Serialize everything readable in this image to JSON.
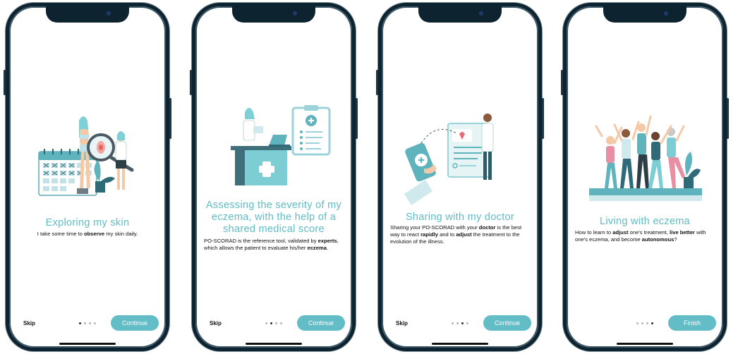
{
  "colors": {
    "accent": "#62bdc7",
    "title": "#5fbcc5",
    "frame": "#0d2330"
  },
  "screens": [
    {
      "title": "Exploring my skin",
      "body": [
        "I take some time to ",
        "observe",
        " my skin daily."
      ],
      "skip": "Skip",
      "button": "Continue",
      "active_dot": 1,
      "dots": 4
    },
    {
      "title": "Assessing the severity of my eczema, with the help of a shared medical score",
      "body": [
        "PO-SCORAD is the reference tool, validated by ",
        "experts",
        ", which allows the patient to evaluate his/her ",
        "eczema",
        "."
      ],
      "skip": "Skip",
      "button": "Continue",
      "active_dot": 2,
      "dots": 4
    },
    {
      "title": "Sharing with my doctor",
      "body": [
        "Sharing your PO-SCORAD with your ",
        "doctor",
        " is the best way to react ",
        "rapidly",
        " and to ",
        "adjust",
        " the treatment to the evolution of the illness."
      ],
      "skip": "Skip",
      "button": "Continue",
      "active_dot": 3,
      "dots": 4
    },
    {
      "title": "Living with eczema",
      "body": [
        "How to learn to ",
        "adjust",
        " one's treatment, ",
        "live better",
        " with one's eczema, and become ",
        "autonomous",
        "?"
      ],
      "skip": "",
      "button": "Finish",
      "active_dot": 4,
      "dots": 4
    }
  ],
  "illustrations": [
    "calendar-magnifier-illustration",
    "doctor-desk-clipboard-illustration",
    "phone-doctor-report-illustration",
    "cheering-group-illustration"
  ]
}
